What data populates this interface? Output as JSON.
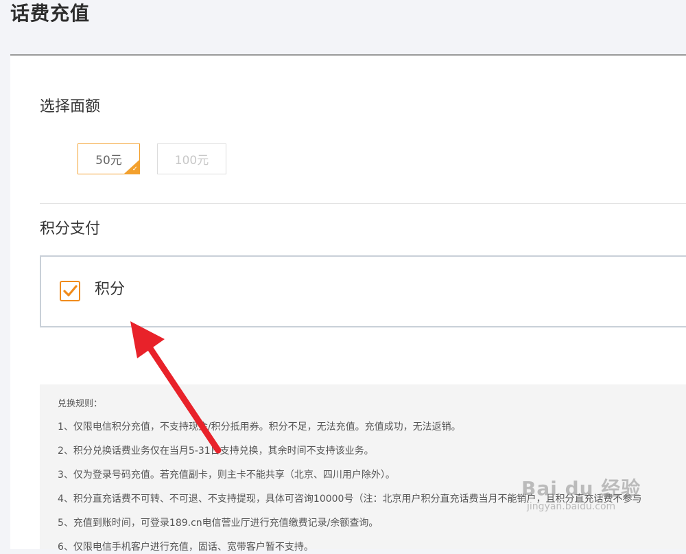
{
  "page": {
    "title": "话费充值"
  },
  "amount_section": {
    "heading": "选择面额",
    "options": [
      {
        "label": "50元",
        "selected": true
      },
      {
        "label": "100元",
        "selected": false
      }
    ]
  },
  "payment_section": {
    "heading": "积分支付",
    "checkbox_label": "积分",
    "checked": true
  },
  "rules": {
    "title": "兑换规则：",
    "items": [
      "1、仅限电信积分充值，不支持现金/积分抵用券。积分不足，无法充值。充值成功，无法返销。",
      "2、积分兑换话费业务仅在当月5-31日支持兑换，其余时间不支持该业务。",
      "3、仅为登录号码充值。若充值副卡，则主卡不能共享（北京、四川用户除外）。",
      "4、积分直充话费不可转、不可退、不支持提现，具体可咨询10000号（注：北京用户积分直充话费当月不能销户，且积分直充话费不参与",
      "5、充值到账时间，可登录189.cn电信营业厅进行充值缴费记录/余额查询。",
      "6、仅限电信手机客户进行充值，固话、宽带客户暂不支持。"
    ]
  },
  "watermark": {
    "brand": "Bai du 经验",
    "url": "jingyan.baidu.com"
  },
  "colors": {
    "accent_orange": "#f3a02d",
    "checkbox_orange": "#f08b1c",
    "annotation_red": "#e8222a"
  }
}
